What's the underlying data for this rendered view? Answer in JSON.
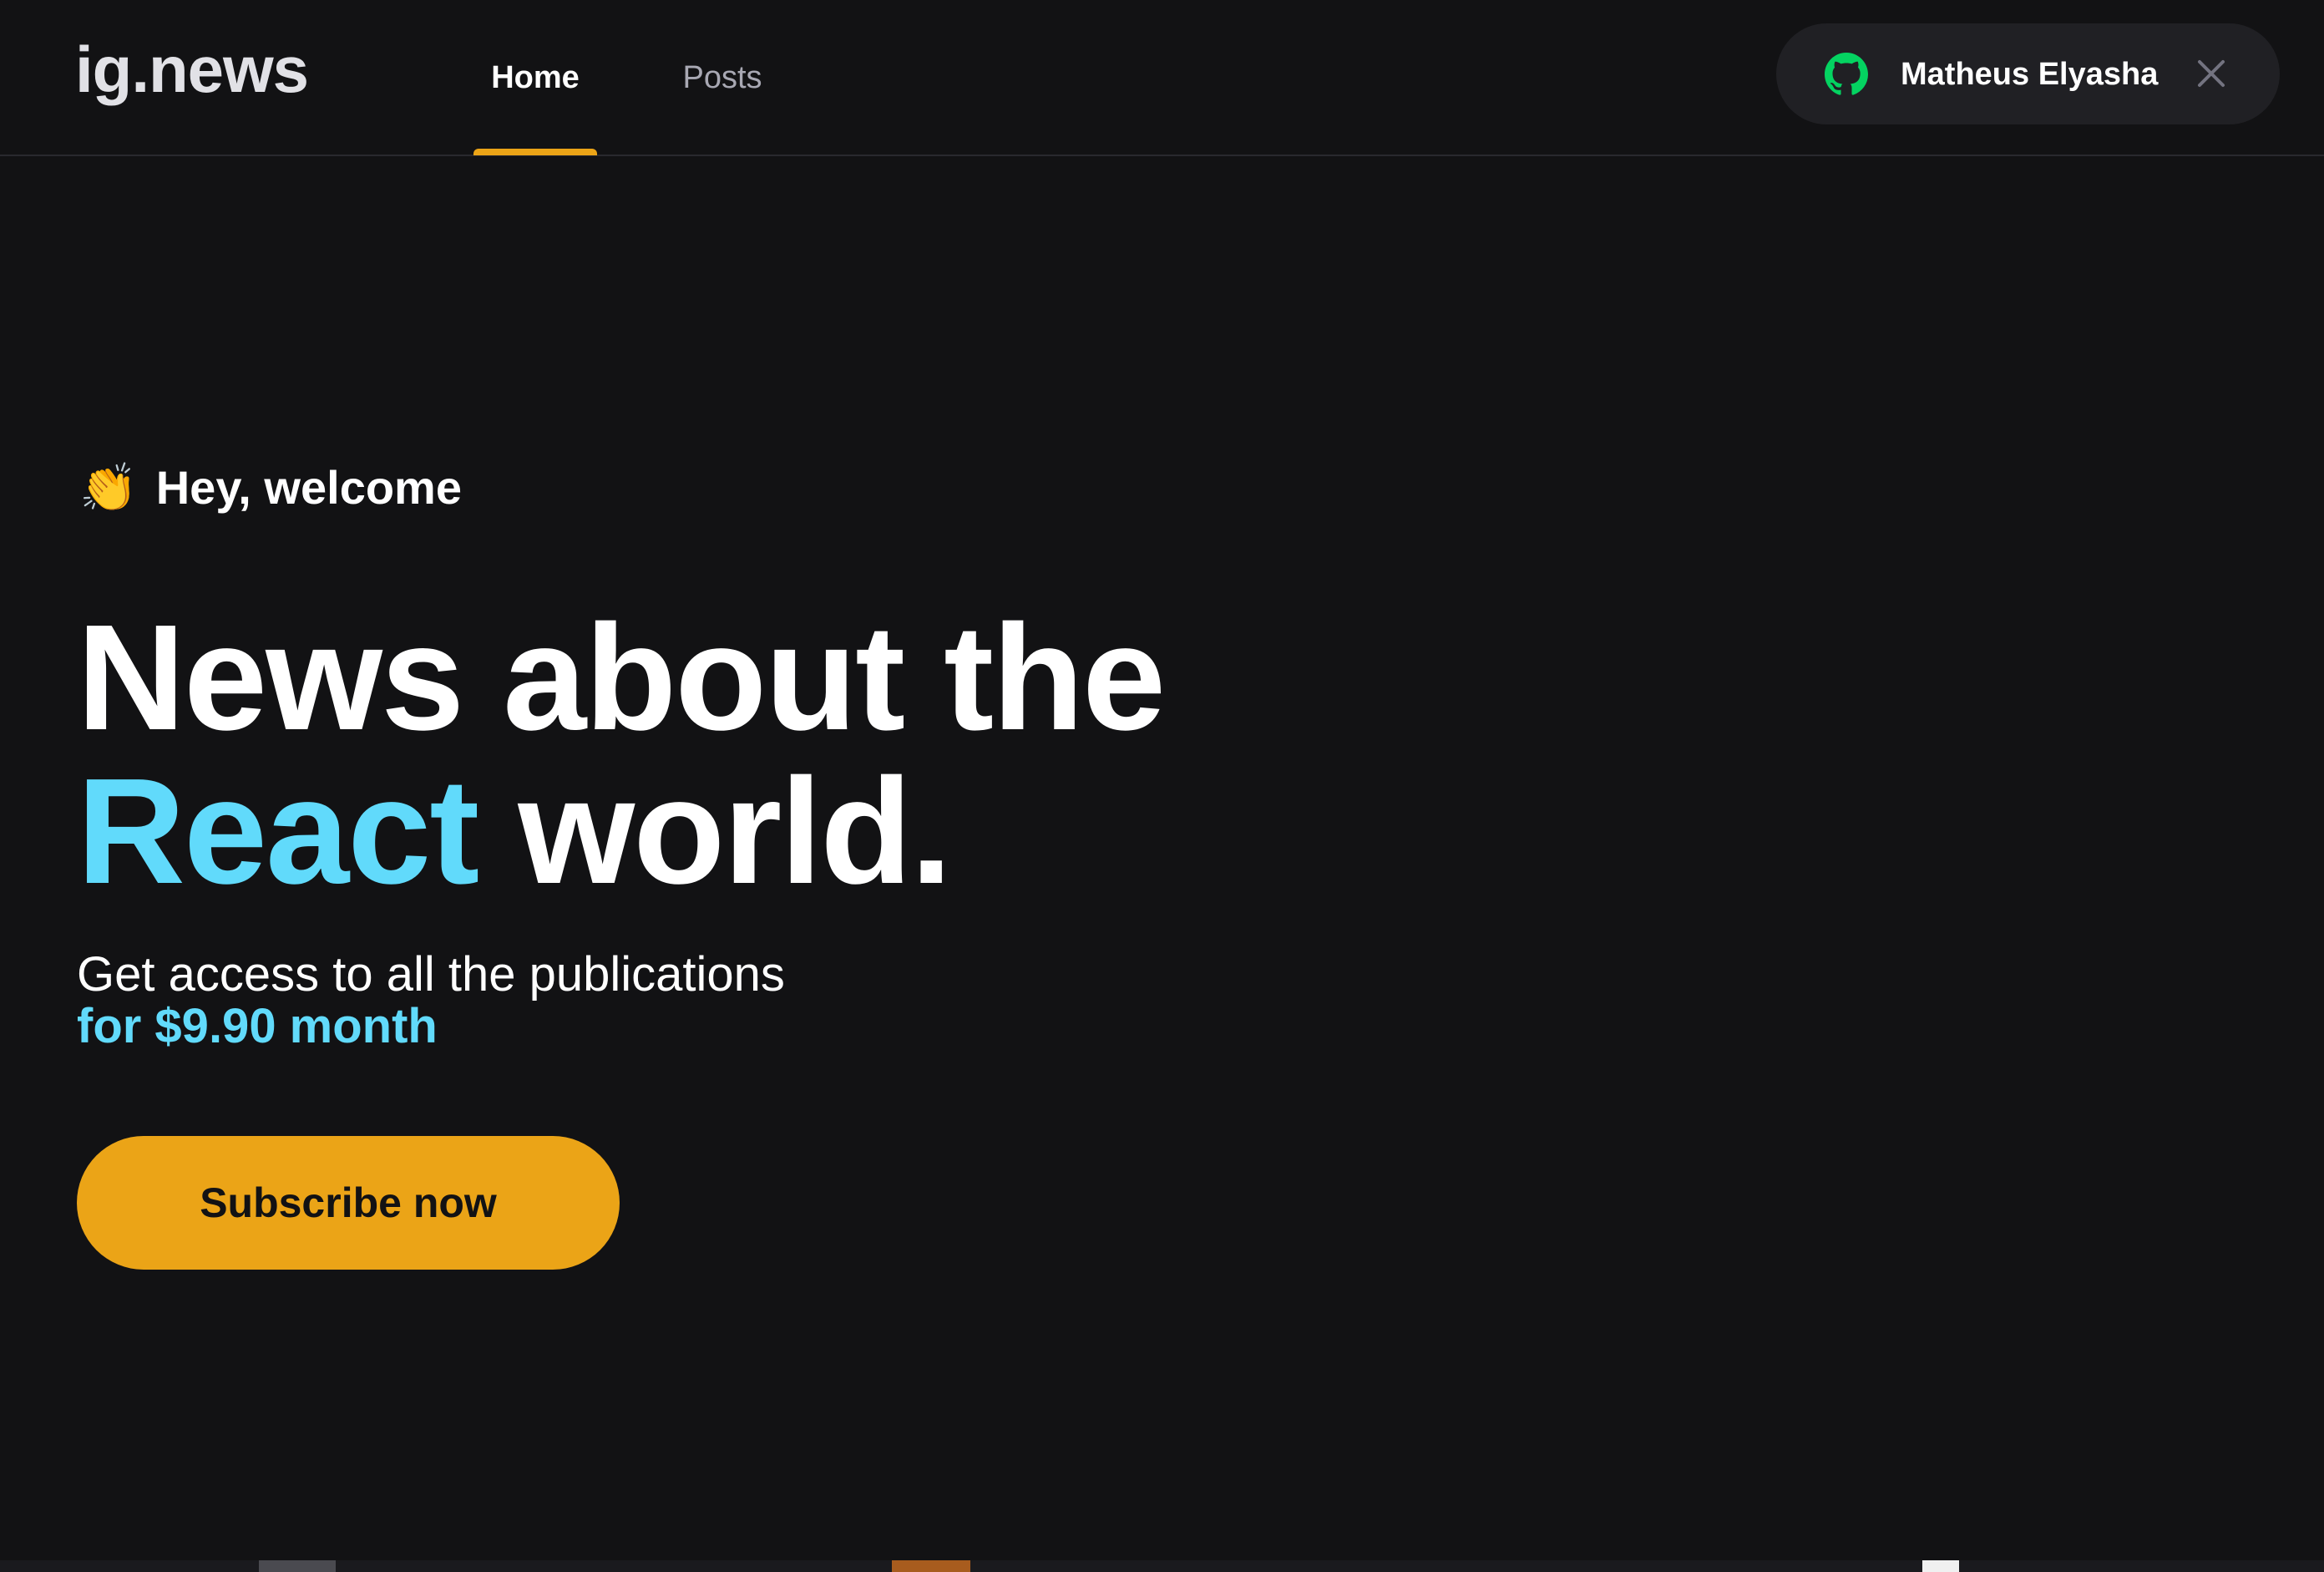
{
  "header": {
    "logo": "ig.news",
    "nav": [
      {
        "label": "Home",
        "active": true
      },
      {
        "label": "Posts",
        "active": false
      }
    ],
    "user": {
      "name": "Matheus Elyasha",
      "provider_icon": "github-icon",
      "action_icon": "close-icon"
    }
  },
  "hero": {
    "welcome_emoji": "👏",
    "welcome_text": "Hey, welcome",
    "title_line1": "News about the",
    "title_accent": "React",
    "title_line2_rest": "world.",
    "subtitle": "Get access to all the publications",
    "price": "for $9.90 month",
    "cta_label": "Subscribe now"
  },
  "colors": {
    "background": "#121214",
    "accent_yellow": "#eba417",
    "accent_cyan": "#61dafb",
    "github_green": "#04d361",
    "pill_bg": "#202024"
  }
}
